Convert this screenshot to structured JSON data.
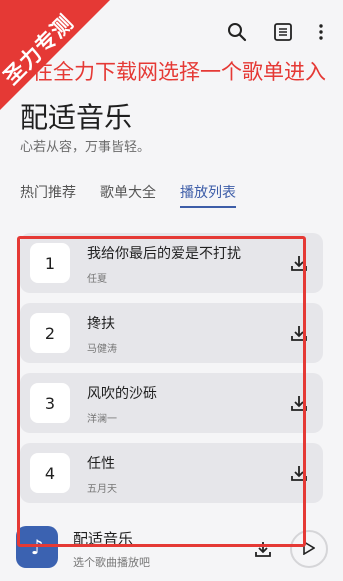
{
  "ribbon": {
    "text": "圣力专测"
  },
  "annotation": {
    "text": "在全力下载网选择一个歌单进入"
  },
  "app": {
    "title": "配适音乐",
    "subtitle": "心若从容，万事皆轻。"
  },
  "tabs": [
    {
      "label": "热门推荐",
      "active": false
    },
    {
      "label": "歌单大全",
      "active": false
    },
    {
      "label": "播放列表",
      "active": true
    }
  ],
  "songs": [
    {
      "index": "1",
      "title": "我给你最后的爱是不打扰",
      "artist": "任夏"
    },
    {
      "index": "2",
      "title": "搀扶",
      "artist": "马健涛"
    },
    {
      "index": "3",
      "title": "风吹的沙砾",
      "artist": "洋澜一"
    },
    {
      "index": "4",
      "title": "任性",
      "artist": "五月天"
    }
  ],
  "player": {
    "title": "配适音乐",
    "subtitle": "选个歌曲播放吧"
  },
  "colors": {
    "accent": "#3d5da8",
    "highlight": "#e53935",
    "cover": "#3b62b1"
  },
  "icons": [
    "search-icon",
    "list-icon",
    "more-vert-icon",
    "download-icon",
    "music-note-icon",
    "play-icon"
  ]
}
